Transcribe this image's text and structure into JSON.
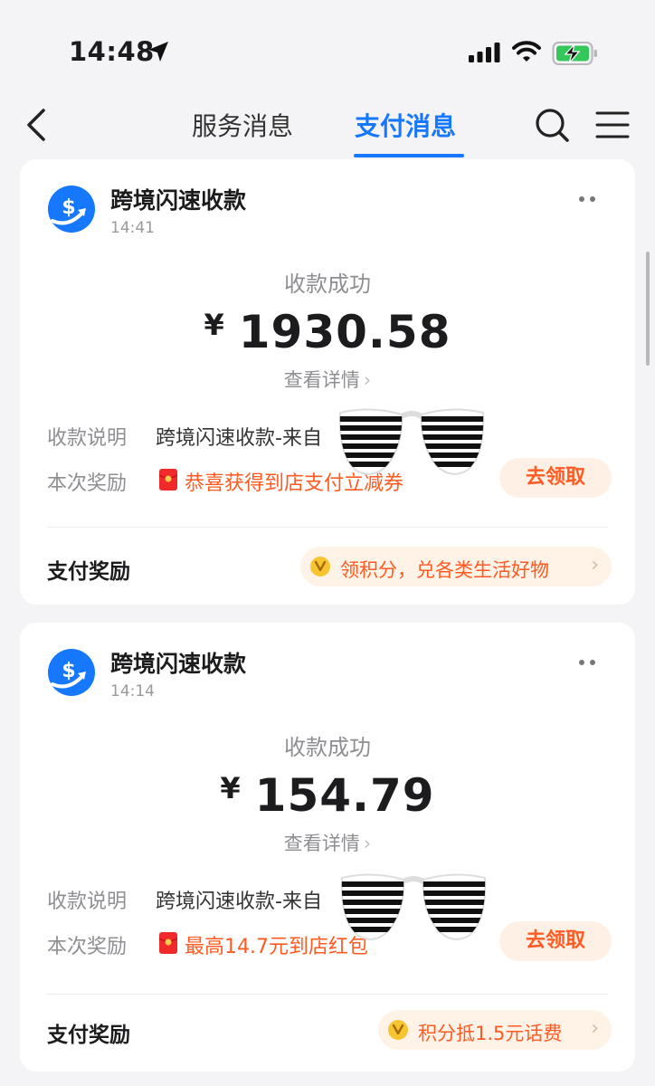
{
  "status_bar": {
    "time": "14:48"
  },
  "nav": {
    "tabs": [
      {
        "label": "服务消息",
        "active": false
      },
      {
        "label": "支付消息",
        "active": true
      }
    ],
    "accent_color": "#1677ff"
  },
  "messages": [
    {
      "sender": "跨境闪速收款",
      "time": "14:41",
      "status": "收款成功",
      "currency": "¥",
      "amount": "1930.58",
      "detail_link": "查看详情",
      "desc_label": "收款说明",
      "desc_value": "跨境闪速收款-来自",
      "reward_label": "本次奖励",
      "reward_value": "恭喜获得到店支付立减券",
      "claim_button": "去领取",
      "pay_reward_label": "支付奖励",
      "pay_reward_pill": "领积分，兑各类生活好物"
    },
    {
      "sender": "跨境闪速收款",
      "time": "14:14",
      "status": "收款成功",
      "currency": "¥",
      "amount": "154.79",
      "detail_link": "查看详情",
      "desc_label": "收款说明",
      "desc_value": "跨境闪速收款-来自",
      "reward_label": "本次奖励",
      "reward_value": "最高14.7元到店红包",
      "claim_button": "去领取",
      "pay_reward_label": "支付奖励",
      "pay_reward_pill": "积分抵1.5元话费"
    }
  ],
  "icons": [
    "location-arrow-icon",
    "cellular-signal-icon",
    "wifi-icon",
    "battery-charging-icon",
    "back-arrow-icon",
    "search-icon",
    "menu-icon",
    "dollar-logo-icon",
    "more-dots-icon",
    "red-packet-icon",
    "gold-coin-icon",
    "chevron-right-icon",
    "shutter-shades-sticker"
  ],
  "colors": {
    "reward_orange": "#ff5a22",
    "battery_green": "#34c759"
  }
}
